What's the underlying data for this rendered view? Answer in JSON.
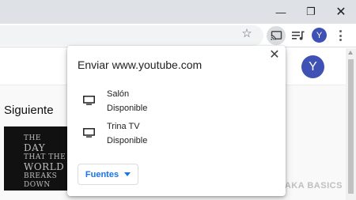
{
  "window": {
    "minimize_glyph": "—",
    "restore_glyph": "❐",
    "close_glyph": "✕"
  },
  "toolbar": {
    "star_icon": "star-icon",
    "cast_icon": "cast-icon",
    "playlist_icon": "media-playlist-icon",
    "profile_initial": "Y",
    "menu_icon": "three-dots-icon"
  },
  "page": {
    "avatar_initial": "Y",
    "next_label": "Siguiente",
    "thumbnail_text": [
      "THE",
      "DAY",
      "THAT THE",
      "WORLD",
      "BREAKS DOWN"
    ]
  },
  "cast_dialog": {
    "title": "Enviar www.youtube.com",
    "close_glyph": "✕",
    "sinks": [
      {
        "name": "Salón",
        "status": "Disponible",
        "icon": "monitor-icon"
      },
      {
        "name": "Trina TV",
        "status": "Disponible",
        "icon": "monitor-icon"
      }
    ],
    "sources_label": "Fuentes"
  },
  "watermark": {
    "text": "XATAKA BASICS"
  },
  "colors": {
    "titlebar": "#dee1e6",
    "accent_blue": "#1a73e8",
    "avatar": "#3f51b5"
  }
}
